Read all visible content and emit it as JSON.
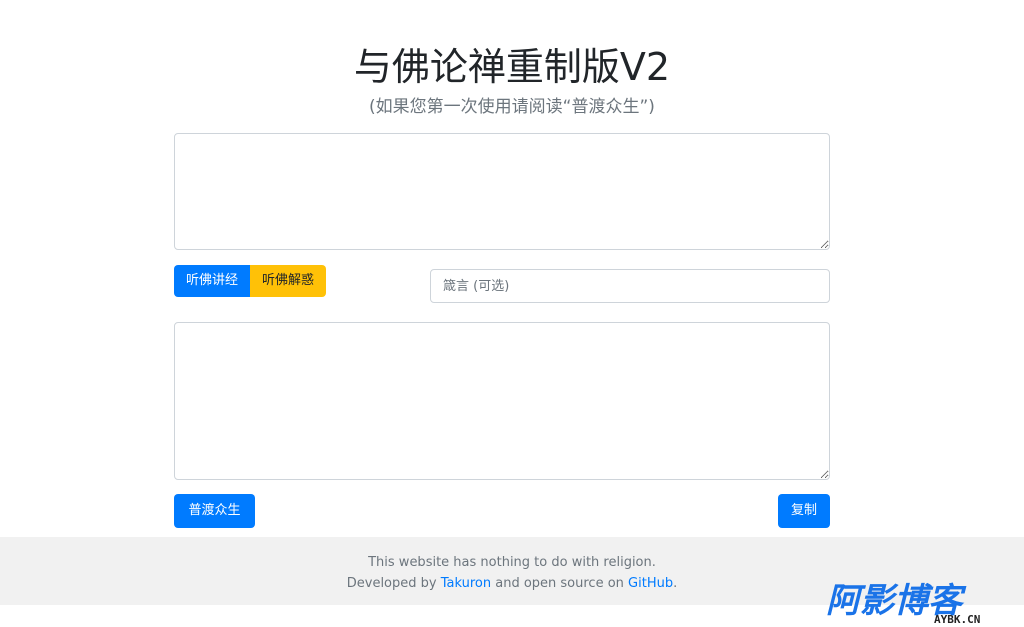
{
  "header": {
    "title": "与佛论禅重制版V2",
    "subtitle": "(如果您第一次使用请阅读“普渡众生”)"
  },
  "input_area": {
    "value": "",
    "placeholder": ""
  },
  "mode_buttons": {
    "encode_label": "听佛讲经",
    "decode_label": "听佛解惑"
  },
  "key_input": {
    "value": "",
    "placeholder": "箴言 (可选)"
  },
  "output_area": {
    "value": "",
    "placeholder": ""
  },
  "actions": {
    "help_label": "普渡众生",
    "copy_label": "复制"
  },
  "footer": {
    "line1": "This website has nothing to do with religion.",
    "line2_prefix": "Developed by ",
    "author_link": "Takuron",
    "line2_middle": " and open source on ",
    "github_link": "GitHub",
    "line2_suffix": "."
  },
  "watermark": {
    "text": "阿影博客",
    "domain": "AYBK.CN",
    "color": "#1a73e8"
  },
  "colors": {
    "primary": "#007bff",
    "warning": "#ffc107",
    "footer_bg": "#f1f1f1",
    "muted": "#6c757d"
  }
}
